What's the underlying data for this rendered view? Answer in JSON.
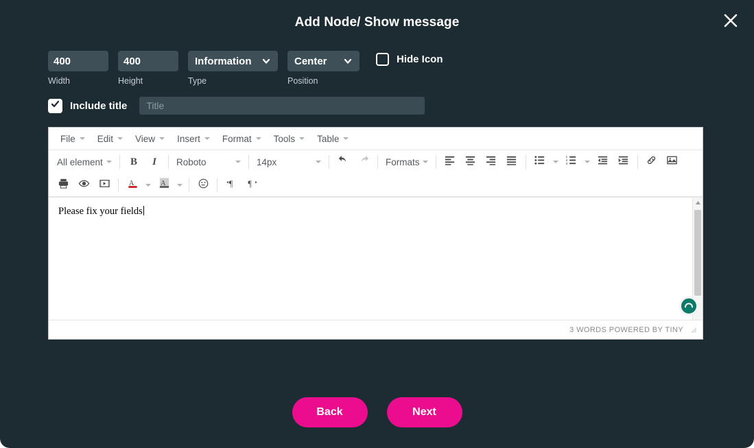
{
  "header": {
    "title": "Add Node/ Show message",
    "close_icon": "close-icon"
  },
  "settings": {
    "width": {
      "value": "400",
      "unit": "px",
      "label": "Width"
    },
    "height": {
      "value": "400",
      "unit": "px",
      "label": "Height"
    },
    "type": {
      "value": "Information",
      "label": "Type"
    },
    "position": {
      "value": "Center",
      "label": "Position"
    },
    "hide_icon": {
      "label": "Hide Icon",
      "checked": false
    }
  },
  "title_row": {
    "include_title_label": "Include title",
    "include_title_checked": true,
    "title_placeholder": "Title",
    "title_value": ""
  },
  "editor": {
    "menubar": [
      {
        "label": "File"
      },
      {
        "label": "Edit"
      },
      {
        "label": "View"
      },
      {
        "label": "Insert"
      },
      {
        "label": "Format"
      },
      {
        "label": "Tools"
      },
      {
        "label": "Table"
      }
    ],
    "toolbar_row1": {
      "element_select": "All element",
      "bold": "B",
      "italic": "I",
      "font_select": "Roboto",
      "size_select": "14px",
      "undo_icon": "undo-icon",
      "redo_icon": "redo-icon",
      "formats_select": "Formats",
      "align_left_icon": "align-left-icon",
      "align_center_icon": "align-center-icon",
      "align_right_icon": "align-right-icon",
      "align_justify_icon": "align-justify-icon",
      "bullet_list_icon": "bullet-list-icon",
      "numbered_list_icon": "numbered-list-icon",
      "outdent_icon": "outdent-icon",
      "indent_icon": "indent-icon",
      "link_icon": "link-icon",
      "image_icon": "image-icon"
    },
    "toolbar_row2": {
      "print_icon": "print-icon",
      "preview_icon": "preview-eye-icon",
      "media_icon": "media-film-icon",
      "text_color_icon": "text-color-icon",
      "background_color_icon": "background-color-icon",
      "emoji_icon": "emoji-smiley-icon",
      "ltr_icon": "direction-ltr-icon",
      "rtl_icon": "direction-rtl-icon"
    },
    "content": "Please fix your fields",
    "statusbar": "3 WORDS POWERED BY TINY"
  },
  "footer": {
    "back_label": "Back",
    "next_label": "Next"
  },
  "colors": {
    "background": "#1d2b33",
    "field": "#3e4f57",
    "accent": "#ec0d8f",
    "spinner": "#0b7a68"
  }
}
